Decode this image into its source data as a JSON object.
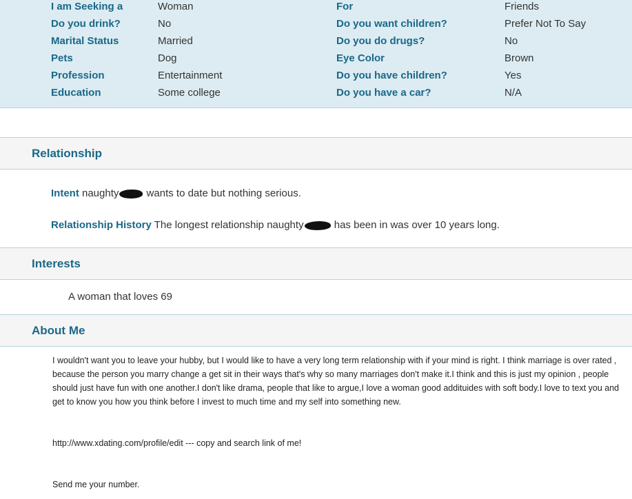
{
  "details": {
    "left": [
      {
        "label": "I am Seeking a",
        "value": "Woman"
      },
      {
        "label": "Do you drink?",
        "value": "No"
      },
      {
        "label": "Marital Status",
        "value": "Married"
      },
      {
        "label": "Pets",
        "value": "Dog"
      },
      {
        "label": "Profession",
        "value": "Entertainment"
      },
      {
        "label": "Education",
        "value": "Some college"
      }
    ],
    "right": [
      {
        "label": "For",
        "value": "Friends"
      },
      {
        "label": "Do you want children?",
        "value": "Prefer Not To Say"
      },
      {
        "label": "Do you do drugs?",
        "value": "No"
      },
      {
        "label": "Eye Color",
        "value": "Brown"
      },
      {
        "label": "Do you have children?",
        "value": "Yes"
      },
      {
        "label": "Do you have a car?",
        "value": "N/A"
      }
    ]
  },
  "relationship": {
    "title": "Relationship",
    "intent_label": "Intent",
    "intent_pre": "naughty",
    "intent_post": " wants to date but nothing serious.",
    "history_label": "Relationship History",
    "history_pre": " The longest relationship naughty",
    "history_post": " has been in was over 10 years long."
  },
  "interests": {
    "title": "Interests",
    "text": "A woman that loves 69"
  },
  "about": {
    "title": "About Me",
    "paragraph1": "I wouldn't want you to leave your hubby, but I would like to have a very long term relationship with if your mind is right. I think marriage is over rated , because the person you marry change a get sit in their ways that's why so many marriages don't make it.I think and this is just my opinion , people should just have fun with one another.I don't like drama, people that like to argue,I love a woman good addituides with soft body.I love to text you and get to know you how you think before I invest to much time and my self into something new.",
    "paragraph2": "http://www.xdating.com/profile/edit --- copy and search link of me!",
    "paragraph3": "Send me your number."
  }
}
